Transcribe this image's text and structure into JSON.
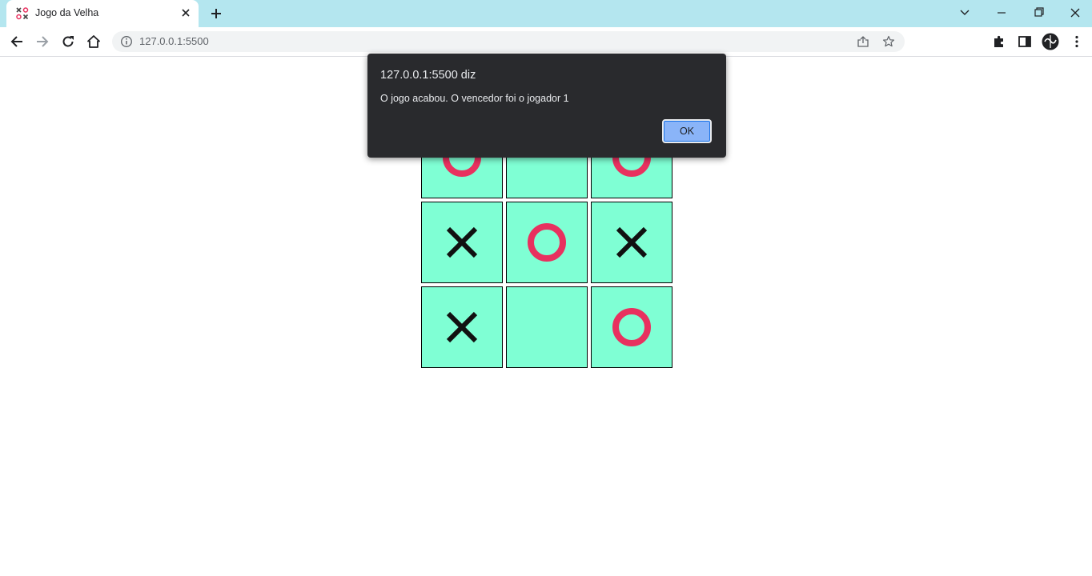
{
  "browser": {
    "tab_title": "Jogo da Velha",
    "url": "127.0.0.1:5500"
  },
  "board": {
    "cells": [
      "O",
      "",
      "O",
      "X",
      "O",
      "X",
      "X",
      "",
      "O"
    ]
  },
  "dialog": {
    "title": "127.0.0.1:5500 diz",
    "message": "O jogo acabou. O vencedor foi o jogador 1",
    "ok_label": "OK"
  },
  "colors": {
    "cell_bg": "#7fffd4",
    "o_mark": "#e8315f",
    "x_mark": "#111111",
    "tabstrip": "#b4e6ef",
    "dialog_bg": "#292a2d",
    "ok_button": "#8ab4f8"
  }
}
